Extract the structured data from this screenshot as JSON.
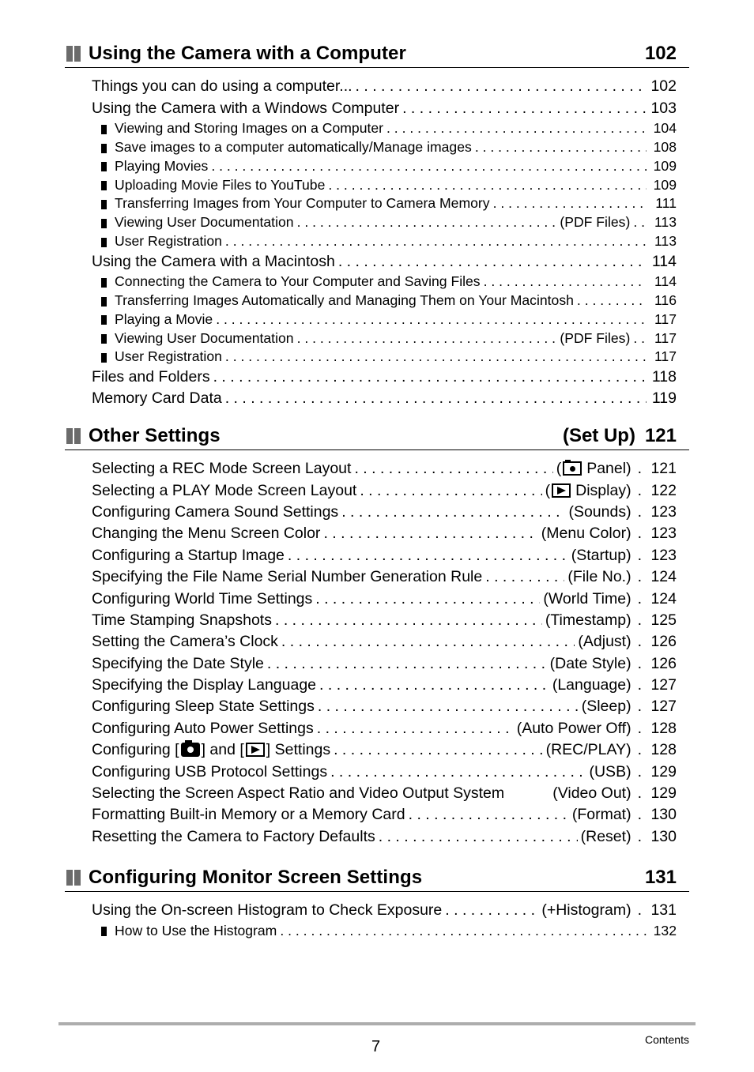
{
  "sections": [
    {
      "title": "Using the Camera with a Computer",
      "tag": "",
      "page": "102",
      "entries": [
        {
          "level": 1,
          "label": "Things you can do using a computer...",
          "tag": "",
          "page": "102"
        },
        {
          "level": 1,
          "label": "Using the Camera with a Windows Computer",
          "tag": "",
          "page": "103"
        },
        {
          "level": 2,
          "label": "Viewing and Storing Images on a Computer",
          "tag": "",
          "page": "104"
        },
        {
          "level": 2,
          "label": "Save images to a computer automatically/Manage images",
          "tag": "",
          "page": "108"
        },
        {
          "level": 2,
          "label": "Playing Movies",
          "tag": "",
          "page": "109"
        },
        {
          "level": 2,
          "label": "Uploading Movie Files to YouTube",
          "tag": "",
          "page": "109"
        },
        {
          "level": 2,
          "label": "Transferring Images from Your Computer to Camera Memory",
          "tag": "",
          "page": "111"
        },
        {
          "level": 2,
          "label": "Viewing User Documentation",
          "tag": "(PDF Files)",
          "page": "113"
        },
        {
          "level": 2,
          "label": "User Registration",
          "tag": "",
          "page": "113"
        },
        {
          "level": 1,
          "label": "Using the Camera with a Macintosh",
          "tag": "",
          "page": "114"
        },
        {
          "level": 2,
          "label": "Connecting the Camera to Your Computer and Saving Files",
          "tag": "",
          "page": "114"
        },
        {
          "level": 2,
          "label": "Transferring Images Automatically and Managing Them on Your Macintosh",
          "tag": "",
          "page": "116"
        },
        {
          "level": 2,
          "label": "Playing a Movie",
          "tag": "",
          "page": "117"
        },
        {
          "level": 2,
          "label": "Viewing User Documentation",
          "tag": "(PDF Files)",
          "page": "117"
        },
        {
          "level": 2,
          "label": "User Registration",
          "tag": "",
          "page": "117"
        },
        {
          "level": 1,
          "label": "Files and Folders",
          "tag": "",
          "page": "118"
        },
        {
          "level": 1,
          "label": "Memory Card Data",
          "tag": "",
          "page": "119"
        }
      ]
    },
    {
      "title": "Other Settings",
      "tag": "(Set Up)",
      "page": "121",
      "entries": [
        {
          "level": 1,
          "label": "Selecting a REC Mode Screen Layout",
          "tag": "Panel)",
          "tag_icon": "rec-panel-icon",
          "page": "121"
        },
        {
          "level": 1,
          "label": "Selecting a PLAY Mode Screen Layout",
          "tag": "Display)",
          "tag_icon": "play-display-icon",
          "page": "122"
        },
        {
          "level": 1,
          "label": "Configuring Camera Sound Settings",
          "tag": "(Sounds)",
          "page": "123"
        },
        {
          "level": 1,
          "label": "Changing the Menu Screen Color",
          "tag": "(Menu Color)",
          "page": "123"
        },
        {
          "level": 1,
          "label": "Configuring a Startup Image",
          "tag": "(Startup)",
          "page": "123"
        },
        {
          "level": 1,
          "label": "Specifying the File Name Serial Number Generation Rule",
          "tag": "(File No.)",
          "page": "124"
        },
        {
          "level": 1,
          "label": "Configuring World Time Settings",
          "tag": "(World Time)",
          "page": "124"
        },
        {
          "level": 1,
          "label": "Time Stamping Snapshots",
          "tag": "(Timestamp)",
          "page": "125"
        },
        {
          "level": 1,
          "label": "Setting the Camera’s Clock",
          "tag": "(Adjust)",
          "page": "126"
        },
        {
          "level": 1,
          "label": "Specifying the Date Style",
          "tag": "(Date Style)",
          "page": "126"
        },
        {
          "level": 1,
          "label": "Specifying the Display Language",
          "tag": "(Language)",
          "page": "127"
        },
        {
          "level": 1,
          "label": "Configuring Sleep State Settings",
          "tag": "(Sleep)",
          "page": "127"
        },
        {
          "level": 1,
          "label": "Configuring Auto Power Settings",
          "tag": "(Auto Power Off)",
          "page": "128"
        },
        {
          "level": 1,
          "label_parts": [
            "Configuring [",
            "] and [",
            "] Settings"
          ],
          "label_icons": [
            "camera-icon",
            "play-icon"
          ],
          "tag": "(REC/PLAY)",
          "page": "128"
        },
        {
          "level": 1,
          "label": "Configuring USB Protocol Settings",
          "tag": "(USB)",
          "page": "129"
        },
        {
          "level": 1,
          "label": "Selecting the Screen Aspect Ratio and Video Output System",
          "tag": "(Video Out)",
          "page": "129",
          "no_dots": true
        },
        {
          "level": 1,
          "label": "Formatting Built-in Memory or a Memory Card",
          "tag": "(Format)",
          "page": "130"
        },
        {
          "level": 1,
          "label": "Resetting the Camera to Factory Defaults",
          "tag": "(Reset)",
          "page": "130"
        }
      ]
    },
    {
      "title": "Configuring Monitor Screen Settings",
      "tag": "",
      "page": "131",
      "entries": [
        {
          "level": 1,
          "label": "Using the On-screen Histogram to Check Exposure",
          "tag": "(+Histogram)",
          "page": "131"
        },
        {
          "level": 2,
          "label": "How to Use the Histogram",
          "tag": "",
          "page": "132"
        }
      ]
    }
  ],
  "footer": {
    "page_number": "7",
    "label": "Contents"
  }
}
